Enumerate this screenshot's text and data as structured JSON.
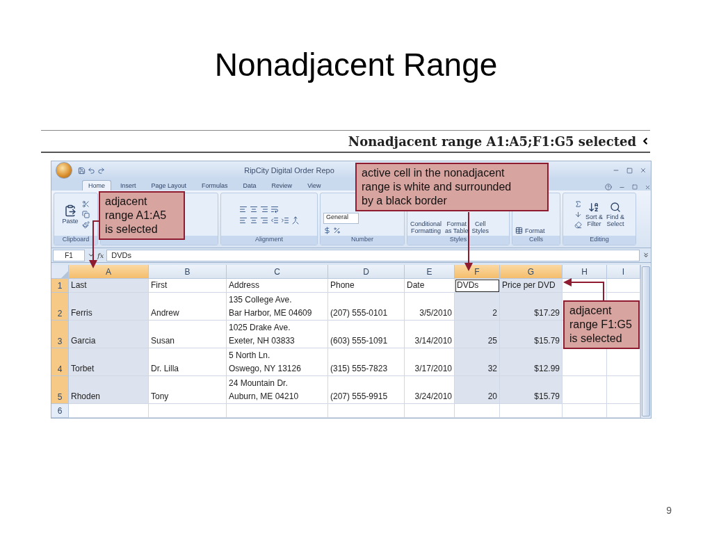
{
  "slide": {
    "title": "Nonadjacent Range",
    "page_number": "9"
  },
  "caption": "Nonadjacent range A1:A5;F1:G5 selected",
  "window": {
    "title": "RipCity Digital Order Repo"
  },
  "ribbon": {
    "tabs": [
      {
        "label": "Home",
        "selected": true
      },
      {
        "label": "Insert",
        "selected": false
      },
      {
        "label": "Page Layout",
        "selected": false
      },
      {
        "label": "Formulas",
        "selected": false
      },
      {
        "label": "Data",
        "selected": false
      },
      {
        "label": "Review",
        "selected": false
      },
      {
        "label": "View",
        "selected": false
      }
    ],
    "groups": [
      {
        "kind": "clipboard",
        "label": "Clipboard",
        "buttons": [
          "Paste"
        ]
      },
      {
        "kind": "font"
      },
      {
        "kind": "alignment",
        "label": "Alignment"
      },
      {
        "kind": "number",
        "label": "Number",
        "field": "General"
      },
      {
        "kind": "styles",
        "label": "Styles",
        "buttons": [
          "Conditional\nFormatting",
          "Format\nas Table",
          "Cell\nStyles"
        ]
      },
      {
        "kind": "cells",
        "label": "Cells",
        "buttons": [
          "Format"
        ]
      },
      {
        "kind": "editing",
        "label": "Editing",
        "buttons": [
          "Sort &\nFilter",
          "Find &\nSelect"
        ]
      }
    ]
  },
  "formula_bar": {
    "name_box": "F1",
    "function_label": "fx",
    "formula": "DVDs"
  },
  "sheet": {
    "columns": [
      {
        "label": "A",
        "selected": true
      },
      {
        "label": "B",
        "selected": false
      },
      {
        "label": "C",
        "selected": false
      },
      {
        "label": "D",
        "selected": false
      },
      {
        "label": "E",
        "selected": false
      },
      {
        "label": "F",
        "selected": true
      },
      {
        "label": "G",
        "selected": true
      },
      {
        "label": "H",
        "selected": false
      },
      {
        "label": "I",
        "selected": false
      }
    ],
    "rows": [
      {
        "number": "1",
        "selected": true,
        "cells": [
          {
            "text": "Last",
            "kind": "text",
            "active": false
          },
          {
            "text": "First",
            "kind": "text",
            "active": false
          },
          {
            "text": "Address",
            "kind": "text",
            "active": false
          },
          {
            "text": "Phone",
            "kind": "text",
            "active": false
          },
          {
            "text": "Date",
            "kind": "text",
            "active": false
          },
          {
            "text": "DVDs",
            "kind": "text",
            "active": true
          },
          {
            "text": "Price per DVD",
            "kind": "text",
            "active": false
          }
        ]
      },
      {
        "number": "2",
        "selected": true,
        "cells": [
          {
            "text": "Ferris",
            "kind": "text",
            "active": false
          },
          {
            "text": "Andrew",
            "kind": "text",
            "active": false
          },
          {
            "text": "135 College Ave.\nBar Harbor, ME 04609",
            "kind": "text",
            "active": false
          },
          {
            "text": "(207) 555-0101",
            "kind": "text",
            "active": false
          },
          {
            "text": "3/5/2010",
            "kind": "number",
            "active": false
          },
          {
            "text": "2",
            "kind": "number",
            "active": false
          },
          {
            "text": "$17.29",
            "kind": "number",
            "active": false
          }
        ]
      },
      {
        "number": "3",
        "selected": true,
        "cells": [
          {
            "text": "Garcia",
            "kind": "text",
            "active": false
          },
          {
            "text": "Susan",
            "kind": "text",
            "active": false
          },
          {
            "text": "1025 Drake Ave.\nExeter, NH 03833",
            "kind": "text",
            "active": false
          },
          {
            "text": "(603) 555-1091",
            "kind": "text",
            "active": false
          },
          {
            "text": "3/14/2010",
            "kind": "number",
            "active": false
          },
          {
            "text": "25",
            "kind": "number",
            "active": false
          },
          {
            "text": "$15.79",
            "kind": "number",
            "active": false
          }
        ]
      },
      {
        "number": "4",
        "selected": true,
        "cells": [
          {
            "text": "Torbet",
            "kind": "text",
            "active": false
          },
          {
            "text": "Dr. Lilla",
            "kind": "text",
            "active": false
          },
          {
            "text": "5 North Ln.\nOswego, NY 13126",
            "kind": "text",
            "active": false
          },
          {
            "text": "(315) 555-7823",
            "kind": "text",
            "active": false
          },
          {
            "text": "3/17/2010",
            "kind": "number",
            "active": false
          },
          {
            "text": "32",
            "kind": "number",
            "active": false
          },
          {
            "text": "$12.99",
            "kind": "number",
            "active": false
          }
        ]
      },
      {
        "number": "5",
        "selected": true,
        "cells": [
          {
            "text": "Rhoden",
            "kind": "text",
            "active": false
          },
          {
            "text": "Tony",
            "kind": "text",
            "active": false
          },
          {
            "text": "24 Mountain Dr.\nAuburn, ME 04210",
            "kind": "text",
            "active": false
          },
          {
            "text": "(207) 555-9915",
            "kind": "text",
            "active": false
          },
          {
            "text": "3/24/2010",
            "kind": "number",
            "active": false
          },
          {
            "text": "20",
            "kind": "number",
            "active": false
          },
          {
            "text": "$15.79",
            "kind": "number",
            "active": false
          }
        ]
      },
      {
        "number": "6",
        "selected": false
      }
    ]
  },
  "callouts": [
    "adjacent\nrange A1:A5\nis selected",
    "active cell in the nonadjacent\nrange is white and surrounded\nby a black border",
    "adjacent\nrange F1:G5\nis selected"
  ]
}
